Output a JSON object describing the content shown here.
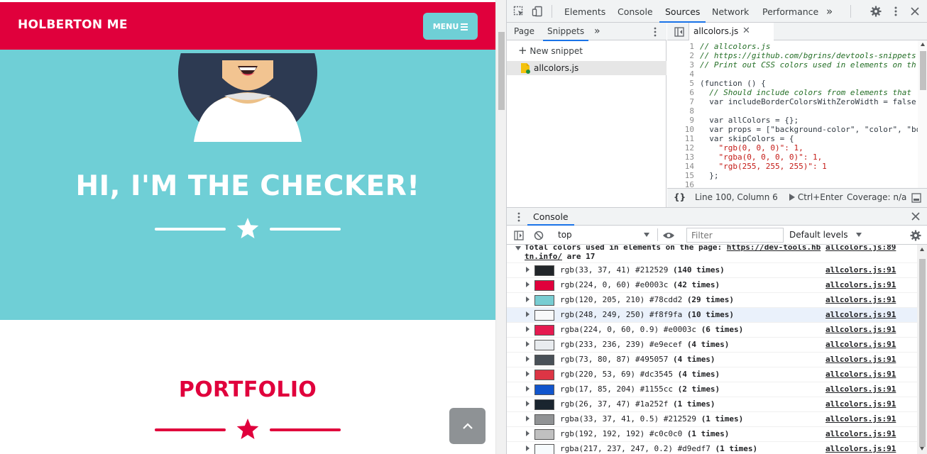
{
  "site": {
    "brand": "HOLBERTON ME",
    "menu_label": "MENU",
    "hero_title": "HI, I'M THE CHECKER!",
    "portfolio_title": "PORTFOLIO",
    "colors": {
      "primary": "#e0003c",
      "masthead": "#6fcfd6",
      "scroll_button": "#8e9295"
    }
  },
  "devtools": {
    "tabs": [
      "Elements",
      "Console",
      "Sources",
      "Network",
      "Performance"
    ],
    "active_tab": "Sources",
    "more_tabs": "»",
    "navigator": {
      "tabs": [
        "Page",
        "Snippets"
      ],
      "active_tab": "Snippets",
      "more": "»",
      "new_snippet_label": "New snippet",
      "snippet_file": "allcolors.js"
    },
    "editor": {
      "open_file": "allcolors.js",
      "lines": [
        {
          "n": "1",
          "text": "// allcolors.js",
          "cls": "tok-comment"
        },
        {
          "n": "2",
          "text": "// https://github.com/bgrins/devtools-snippets",
          "cls": "tok-comment"
        },
        {
          "n": "3",
          "text": "// Print out CSS colors used in elements on th",
          "cls": "tok-comment"
        },
        {
          "n": "4",
          "text": "",
          "cls": "tok-def"
        },
        {
          "n": "5",
          "text": "(function () {",
          "cls": "tok-def"
        },
        {
          "n": "6",
          "text": "  // Should include colors from elements that",
          "cls": "tok-comment"
        },
        {
          "n": "7",
          "text": "  var includeBorderColorsWithZeroWidth = false",
          "cls": "tok-def"
        },
        {
          "n": "8",
          "text": "",
          "cls": "tok-def"
        },
        {
          "n": "9",
          "text": "  var allColors = {};",
          "cls": "tok-def"
        },
        {
          "n": "10",
          "text": "  var props = [\"background-color\", \"color\", \"bo",
          "cls": "tok-def"
        },
        {
          "n": "11",
          "text": "  var skipColors = {",
          "cls": "tok-def"
        },
        {
          "n": "12",
          "text": "    \"rgb(0, 0, 0)\": 1,",
          "cls": "tok-str"
        },
        {
          "n": "13",
          "text": "    \"rgba(0, 0, 0, 0)\": 1,",
          "cls": "tok-str"
        },
        {
          "n": "14",
          "text": "    \"rgb(255, 255, 255)\": 1",
          "cls": "tok-str"
        },
        {
          "n": "15",
          "text": "  };",
          "cls": "tok-def"
        },
        {
          "n": "16",
          "text": "",
          "cls": "tok-def"
        }
      ]
    },
    "status": {
      "format_label": "{}",
      "position": "Line 100, Column 6",
      "run_label": "Ctrl+Enter",
      "coverage": "Coverage: n/a"
    },
    "drawer": {
      "tab": "Console",
      "context": "top",
      "filter_placeholder": "Filter",
      "levels": "Default levels"
    },
    "console": {
      "head_text_1": "Total colors used in elements on the page: ",
      "head_link_1": "https://dev-tools.hb",
      "head_link_2": "tn.info/",
      "head_text_2": " are 17",
      "head_src": "allcolors.js:89",
      "rows": [
        {
          "swatch": "#212529",
          "value": "rgb(33, 37, 41) #212529",
          "count": "(140 times)",
          "src": "allcolors.js:91"
        },
        {
          "swatch": "#e0003c",
          "value": "rgb(224, 0, 60) #e0003c",
          "count": "(42 times)",
          "src": "allcolors.js:91"
        },
        {
          "swatch": "#78cdd2",
          "value": "rgb(120, 205, 210) #78cdd2",
          "count": "(29 times)",
          "src": "allcolors.js:91"
        },
        {
          "swatch": "#f8f9fa",
          "value": "rgb(248, 249, 250) #f8f9fa",
          "count": "(10 times)",
          "src": "allcolors.js:91"
        },
        {
          "swatch": "#e51a50",
          "value": "rgba(224, 0, 60, 0.9) #e0003c",
          "count": "(6 times)",
          "src": "allcolors.js:91"
        },
        {
          "swatch": "#e9ecef",
          "value": "rgb(233, 236, 239) #e9ecef",
          "count": "(4 times)",
          "src": "allcolors.js:91"
        },
        {
          "swatch": "#495057",
          "value": "rgb(73, 80, 87) #495057",
          "count": "(4 times)",
          "src": "allcolors.js:91"
        },
        {
          "swatch": "#dc3545",
          "value": "rgb(220, 53, 69) #dc3545",
          "count": "(4 times)",
          "src": "allcolors.js:91"
        },
        {
          "swatch": "#1155cc",
          "value": "rgb(17, 85, 204) #1155cc",
          "count": "(2 times)",
          "src": "allcolors.js:91"
        },
        {
          "swatch": "#1a252f",
          "value": "rgb(26, 37, 47) #1a252f",
          "count": "(1 times)",
          "src": "allcolors.js:91"
        },
        {
          "swatch": "#909294",
          "value": "rgba(33, 37, 41, 0.5) #212529",
          "count": "(1 times)",
          "src": "allcolors.js:91"
        },
        {
          "swatch": "#c0c0c0",
          "value": "rgb(192, 192, 192) #c0c0c0",
          "count": "(1 times)",
          "src": "allcolors.js:91"
        },
        {
          "swatch": "#f7fbfd",
          "value": "rgba(217, 237, 247, 0.2) #d9edf7",
          "count": "(1 times)",
          "src": "allcolors.js:91"
        }
      ]
    }
  }
}
